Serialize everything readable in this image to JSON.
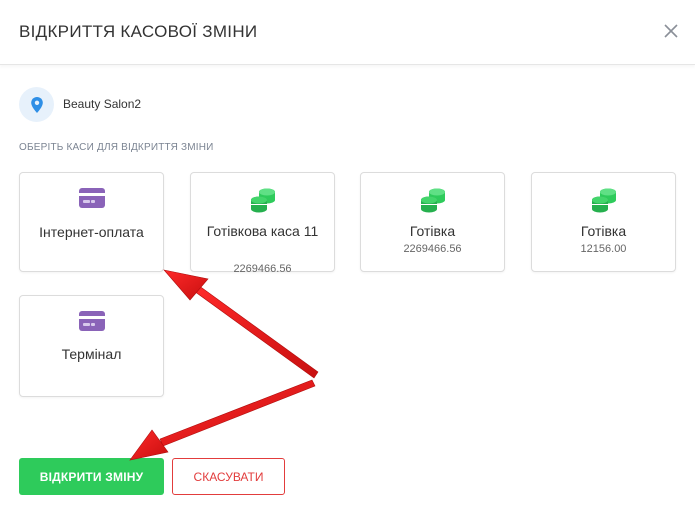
{
  "dialog": {
    "title": "ВІДКРИТТЯ КАСОВОЇ ЗМІНИ"
  },
  "location": {
    "name": "Beauty Salon2",
    "icon": "map-pin-icon"
  },
  "section_label": "ОБЕРІТЬ КАСИ ДЛЯ ВІДКРИТТЯ ЗМІНИ",
  "registers": [
    {
      "name": "Інтернет-оплата",
      "amount": "",
      "icon": "credit-card-icon"
    },
    {
      "name": "Готівкова каса 11",
      "amount": "2269466.56",
      "icon": "coins-icon"
    },
    {
      "name": "Готівка",
      "amount": "2269466.56",
      "icon": "coins-icon"
    },
    {
      "name": "Готівка",
      "amount": "12156.00",
      "icon": "coins-icon"
    },
    {
      "name": "Термінал",
      "amount": "",
      "icon": "credit-card-icon"
    }
  ],
  "buttons": {
    "open": "ВІДКРИТИ ЗМІНУ",
    "cancel": "СКАСУВАТИ"
  },
  "colors": {
    "accent_green": "#2ecb5b",
    "cancel_red": "#e23c3c",
    "card_icon_purple": "#8a63b8",
    "coins_green": "#2ecb5b",
    "annotation_arrow": "#e01b1b"
  }
}
